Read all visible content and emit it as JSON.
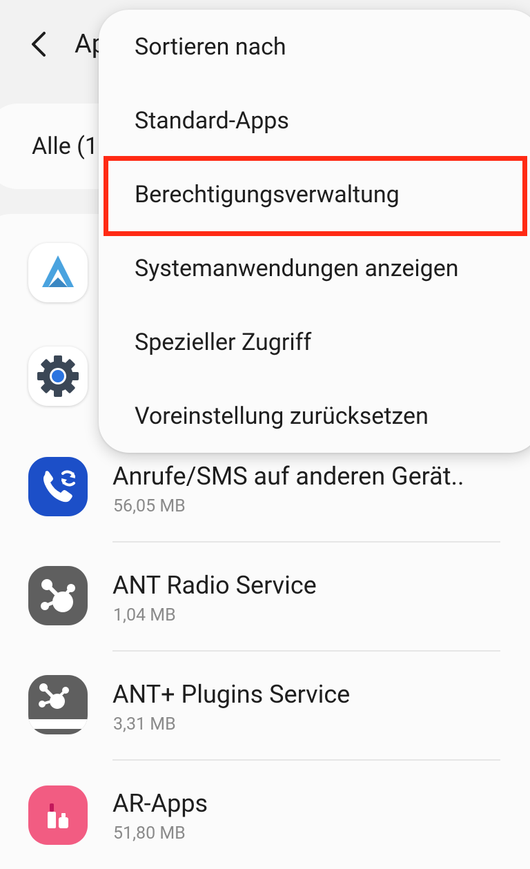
{
  "header": {
    "back_label": "Zurück",
    "title": "Apps"
  },
  "filter": {
    "label": "Alle (1"
  },
  "apps": [
    {
      "name": "",
      "size": "",
      "icon": "android-auto-icon"
    },
    {
      "name": "",
      "size": "",
      "icon": "settings-gear-icon"
    },
    {
      "name": "Anrufe/SMS auf anderen Gerät..",
      "size": "56,05 MB",
      "icon": "call-sync-icon"
    },
    {
      "name": "ANT Radio Service",
      "size": "1,04 MB",
      "icon": "ant-radio-icon"
    },
    {
      "name": "ANT+ Plugins Service",
      "size": "3,31 MB",
      "icon": "ant-plus-icon"
    },
    {
      "name": "AR-Apps",
      "size": "51,80 MB",
      "icon": "ar-apps-icon"
    }
  ],
  "menu": {
    "items": [
      {
        "label": "Sortieren nach"
      },
      {
        "label": "Standard-Apps"
      },
      {
        "label": "Berechtigungsverwaltung"
      },
      {
        "label": "Systemanwendungen anzeigen"
      },
      {
        "label": "Spezieller Zugriff"
      },
      {
        "label": "Voreinstellung zurücksetzen"
      }
    ],
    "highlighted_item": "Berechtigungsverwaltung"
  },
  "colors": {
    "background": "#f2f2f2",
    "card": "#fbfbfb",
    "highlight": "#ff2a14",
    "secondary_text": "#8a8a8a"
  }
}
